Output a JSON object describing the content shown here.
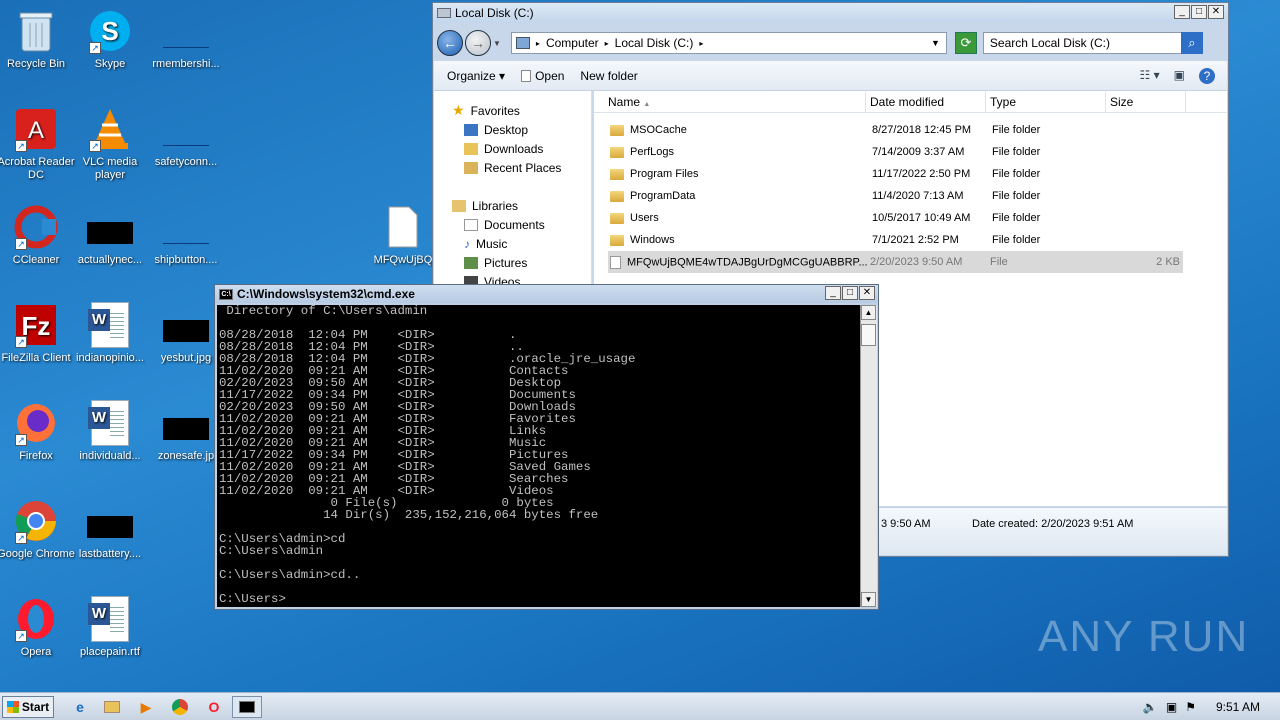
{
  "desktop": {
    "icons": [
      {
        "label": "Recycle Bin"
      },
      {
        "label": "Skype"
      },
      {
        "label": "rmembershi..."
      },
      {
        "label": "Acrobat Reader DC"
      },
      {
        "label": "VLC media player"
      },
      {
        "label": "safetyconn..."
      },
      {
        "label": "CCleaner"
      },
      {
        "label": "actuallynec..."
      },
      {
        "label": "shipbutton...."
      },
      {
        "label": "MFQwUjBQ"
      },
      {
        "label": "FileZilla Client"
      },
      {
        "label": "indianopinio..."
      },
      {
        "label": "yesbut.jpg"
      },
      {
        "label": "Firefox"
      },
      {
        "label": "individuald..."
      },
      {
        "label": "zonesafe.jp"
      },
      {
        "label": "Google Chrome"
      },
      {
        "label": "lastbattery...."
      },
      {
        "label": "Opera"
      },
      {
        "label": "placepain.rtf"
      }
    ]
  },
  "explorer": {
    "title": "Local Disk (C:)",
    "address": [
      "Computer",
      "Local Disk (C:)"
    ],
    "search_placeholder": "Search Local Disk (C:)",
    "toolbar": {
      "organize": "Organize",
      "open": "Open",
      "new_folder": "New folder"
    },
    "nav": {
      "favorites": "Favorites",
      "desktop": "Desktop",
      "downloads": "Downloads",
      "recent": "Recent Places",
      "libraries": "Libraries",
      "documents": "Documents",
      "music": "Music",
      "pictures": "Pictures",
      "videos": "Videos"
    },
    "columns": {
      "name": "Name",
      "date": "Date modified",
      "type": "Type",
      "size": "Size"
    },
    "files": [
      {
        "name": "MSOCache",
        "date": "8/27/2018 12:45 PM",
        "type": "File folder",
        "size": ""
      },
      {
        "name": "PerfLogs",
        "date": "7/14/2009 3:37 AM",
        "type": "File folder",
        "size": ""
      },
      {
        "name": "Program Files",
        "date": "11/17/2022 2:50 PM",
        "type": "File folder",
        "size": ""
      },
      {
        "name": "ProgramData",
        "date": "11/4/2020 7:13 AM",
        "type": "File folder",
        "size": ""
      },
      {
        "name": "Users",
        "date": "10/5/2017 10:49 AM",
        "type": "File folder",
        "size": ""
      },
      {
        "name": "Windows",
        "date": "7/1/2021 2:52 PM",
        "type": "File folder",
        "size": ""
      },
      {
        "name": "MFQwUjBQME4wTDAJBgUrDgMCGgUABBRP...",
        "date": "2/20/2023 9:50 AM",
        "type": "File",
        "size": "2 KB"
      }
    ],
    "details": {
      "modified_fragment": "3 9:50 AM",
      "created": "Date created: 2/20/2023 9:51 AM"
    }
  },
  "cmd": {
    "title": "C:\\Windows\\system32\\cmd.exe",
    "output": " Directory of C:\\Users\\admin\n\n08/28/2018  12:04 PM    <DIR>          .\n08/28/2018  12:04 PM    <DIR>          ..\n08/28/2018  12:04 PM    <DIR>          .oracle_jre_usage\n11/02/2020  09:21 AM    <DIR>          Contacts\n02/20/2023  09:50 AM    <DIR>          Desktop\n11/17/2022  09:34 PM    <DIR>          Documents\n02/20/2023  09:50 AM    <DIR>          Downloads\n11/02/2020  09:21 AM    <DIR>          Favorites\n11/02/2020  09:21 AM    <DIR>          Links\n11/02/2020  09:21 AM    <DIR>          Music\n11/17/2022  09:34 PM    <DIR>          Pictures\n11/02/2020  09:21 AM    <DIR>          Saved Games\n11/02/2020  09:21 AM    <DIR>          Searches\n11/02/2020  09:21 AM    <DIR>          Videos\n               0 File(s)              0 bytes\n              14 Dir(s)  235,152,216,064 bytes free\n\nC:\\Users\\admin>cd\nC:\\Users\\admin\n\nC:\\Users\\admin>cd..\n\nC:\\Users>"
  },
  "taskbar": {
    "start": "Start",
    "clock": "9:51 AM"
  },
  "watermark": "ANY RUN"
}
